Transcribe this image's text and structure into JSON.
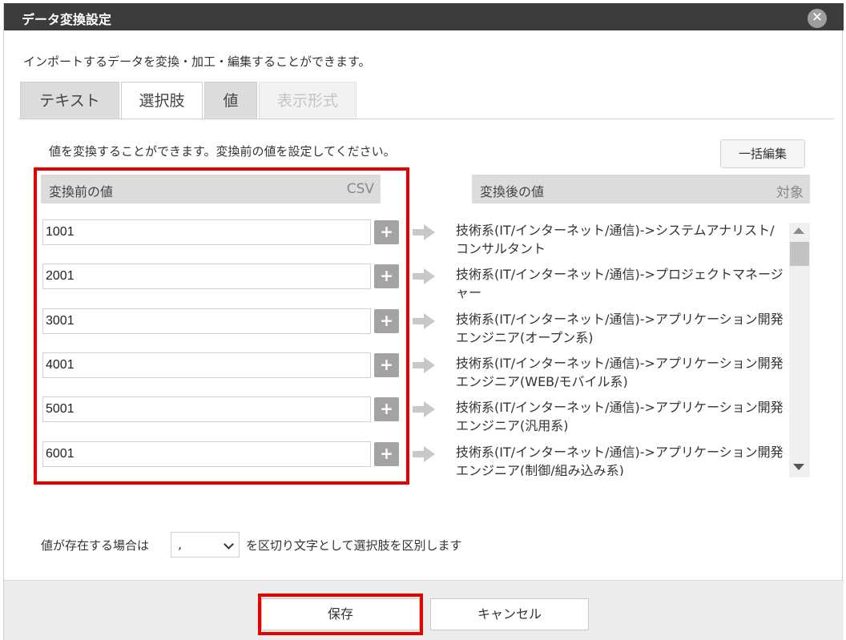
{
  "dialog": {
    "title": "データ変換設定",
    "close_glyph": "✕",
    "description": "インポートするデータを変換・加工・編集することができます。"
  },
  "tabs": [
    {
      "label": "テキスト",
      "state": "inactive"
    },
    {
      "label": "選択肢",
      "state": "active"
    },
    {
      "label": "値",
      "state": "inactive"
    },
    {
      "label": "表示形式",
      "state": "disabled"
    }
  ],
  "panel": {
    "description": "値を変換することができます。変換前の値を設定してください。",
    "bulk_edit_label": "一括編集",
    "before_header": "変換前の値",
    "before_tag": "CSV",
    "after_header": "変換後の値",
    "after_tag": "対象",
    "plus_glyph": "+"
  },
  "rows": [
    {
      "before": "1001",
      "after": "技術系(IT/インターネット/通信)->システムアナリスト/コンサルタント"
    },
    {
      "before": "2001",
      "after": "技術系(IT/インターネット/通信)->プロジェクトマネージャー"
    },
    {
      "before": "3001",
      "after": "技術系(IT/インターネット/通信)->アプリケーション開発エンジニア(オープン系)"
    },
    {
      "before": "4001",
      "after": "技術系(IT/インターネット/通信)->アプリケーション開発エンジニア(WEB/モバイル系)"
    },
    {
      "before": "5001",
      "after": "技術系(IT/インターネット/通信)->アプリケーション開発エンジニア(汎用系)"
    },
    {
      "before": "6001",
      "after": "技術系(IT/インターネット/通信)->アプリケーション開発エンジニア(制御/組み込み系)"
    }
  ],
  "delimiter": {
    "label_pre": "値が存在する場合は",
    "value": ",",
    "label_post": "を区切り文字として選択肢を区別します"
  },
  "footer": {
    "save_label": "保存",
    "cancel_label": "キャンセル"
  },
  "colors": {
    "highlight": "#e60000",
    "titlebar": "#3c3c3c"
  }
}
